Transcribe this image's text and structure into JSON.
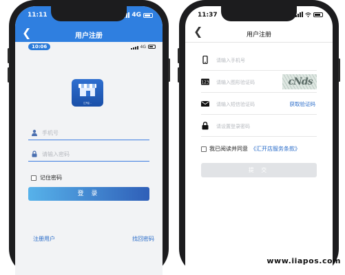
{
  "left_phone": {
    "status_time": "11:11",
    "status_network": "4G",
    "header_title": "用户注册",
    "inner_status_time": "10:06",
    "inner_status_network": "4G",
    "logo_caption": "汇开店 ..",
    "phone_placeholder": "手机号",
    "password_placeholder": "请输入密码",
    "remember_label": "记住密码",
    "login_button": "登 录",
    "register_link": "注册用户",
    "forgot_link": "找回密码",
    "accent_color": "#2f7fe0"
  },
  "right_phone": {
    "status_time": "11:37",
    "header_title": "用户注册",
    "phone_placeholder": "请输入手机号",
    "image_code_placeholder": "请输入图形验证码",
    "captcha_text": "cNds",
    "sms_code_placeholder": "请输入短信验证码",
    "get_code_label": "获取验证码",
    "password_placeholder": "请设置登录密码",
    "agree_prefix": "我已阅读并同意",
    "terms_link": "《汇开店服务条款》",
    "submit_button": "提 交"
  },
  "watermark": "www.iiapos.com",
  "icons": [
    "back-icon",
    "signal-icon",
    "battery-icon",
    "wifi-icon",
    "user-icon",
    "lock-icon",
    "phone-icon",
    "captcha-123-icon",
    "envelope-icon",
    "checkbox-icon",
    "app-logo-icon"
  ]
}
